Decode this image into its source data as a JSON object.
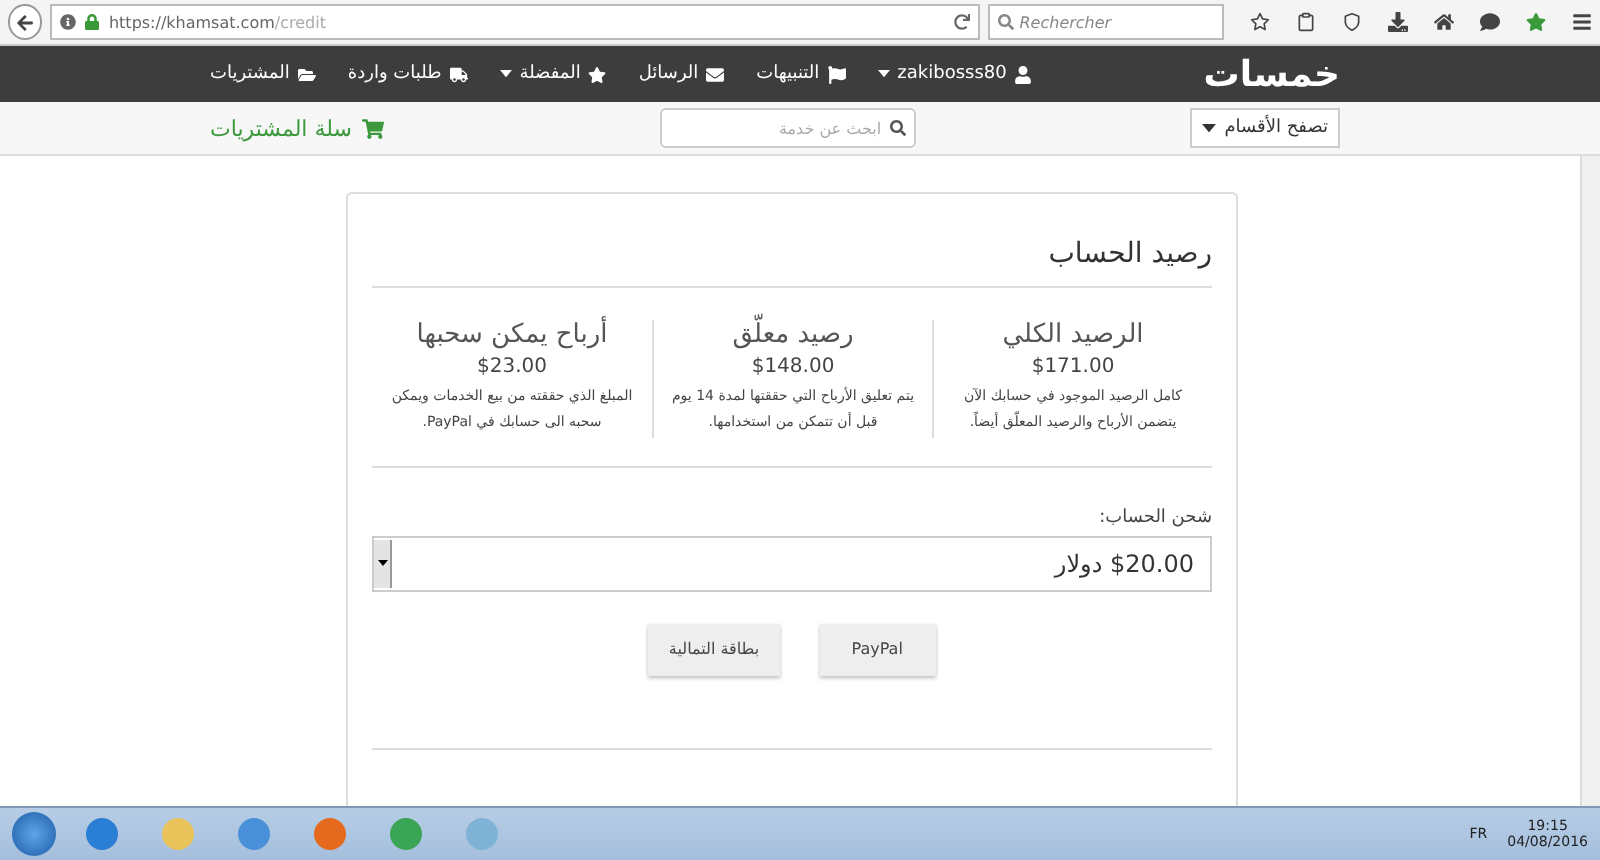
{
  "browser": {
    "url_host": "https://khamsat.com",
    "url_path": "/credit",
    "search_placeholder": "Rechercher"
  },
  "navbar": {
    "logo": "خمسات",
    "items": [
      {
        "label": "zakibosss80",
        "caret": true
      },
      {
        "label": "التنبيهات",
        "caret": false
      },
      {
        "label": "الرسائل",
        "caret": false
      },
      {
        "label": "المفضلة",
        "caret": true
      },
      {
        "label": "طلبات واردة",
        "caret": false
      },
      {
        "label": "المشتريات",
        "caret": false
      }
    ]
  },
  "subbar": {
    "browse": "تصفح الأقسام",
    "search_placeholder": "ابحث عن خدمة",
    "cart": "سلة المشتريات"
  },
  "card": {
    "title": "رصيد الحساب",
    "balances": [
      {
        "title": "الرصيد الكلي",
        "amount": "$171.00",
        "description": "كامل الرصيد الموجود في حسابك الآن يتضمن الأرباح والرصيد المعلّق أيضاً."
      },
      {
        "title": "رصيد معلّق",
        "amount": "$148.00",
        "description": "يتم تعليق الأرباح التي حققتها لمدة 14 يوم قبل أن تتمكن من استخدامها."
      },
      {
        "title": "أرباح يمكن سحبها",
        "amount": "$23.00",
        "description": "المبلغ الذي حققته من بيع الخدمات ويمكن سحبه الى حسابك في PayPal."
      }
    ],
    "charge_label": "شحن الحساب:",
    "amount_value": "$20.00 دولار",
    "buttons": [
      "PayPal",
      "بطاقة التمالية"
    ]
  },
  "taskbar": {
    "language": "FR",
    "time": "19:15",
    "date": "04/08/2016"
  }
}
